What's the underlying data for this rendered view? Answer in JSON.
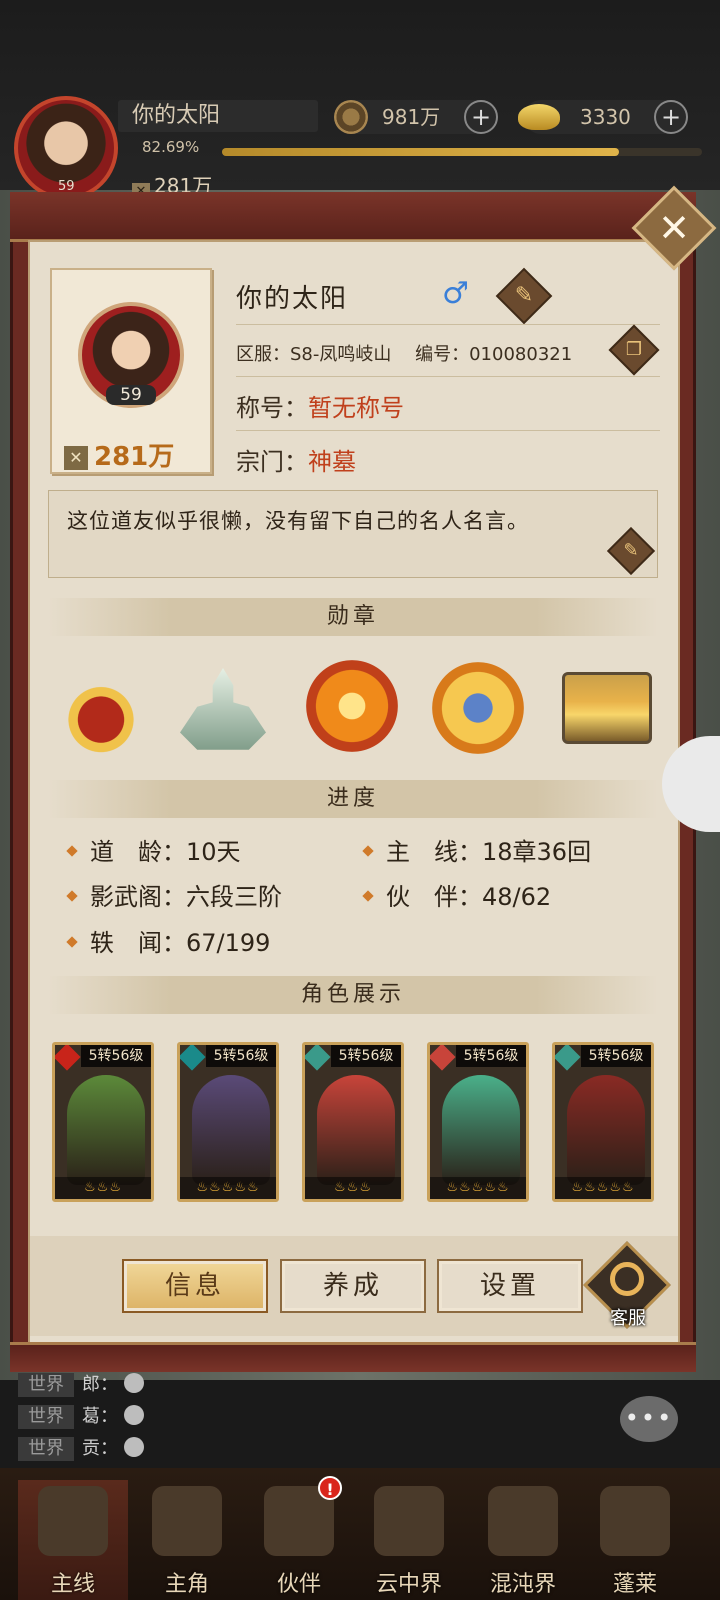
{
  "top_bar": {
    "player_name": "你的太阳",
    "level": "59",
    "exp_percent_text": "82.69%",
    "exp_fraction": 0.8269,
    "power": "281万",
    "coins": "981万",
    "ingots": "3330"
  },
  "profile": {
    "name": "你的太阳",
    "gender_symbol": "♂",
    "level": "59",
    "power": "281万",
    "server_label": "区服：",
    "server_value": "S8-凤鸣岐山",
    "id_label": "编号：",
    "id_value": "010080321",
    "title_label": "称号：",
    "title_value": "暂无称号",
    "sect_label": "宗门：",
    "sect_value": "神墓",
    "motto": "这位道友似乎很懒，没有留下自己的名人名言。"
  },
  "sections": {
    "medals": "勋章",
    "progress": "进度",
    "characters": "角色展示"
  },
  "progress": {
    "dao_age_label": "道　龄：",
    "dao_age_value": "10天",
    "main_line_label": "主　线：",
    "main_line_value": "18章36回",
    "shadow_label": "影武阁：",
    "shadow_value": "六段三阶",
    "partner_label": "伙　伴：",
    "partner_value": "48/62",
    "lore_label": "轶　闻：",
    "lore_value": "67/199"
  },
  "heroes": [
    {
      "level": "5转56级",
      "stars": "♨♨♨",
      "color": "#5c8a3a"
    },
    {
      "level": "5转56级",
      "stars": "♨♨♨♨♨",
      "color": "#5a4a78"
    },
    {
      "level": "5转56级",
      "stars": "♨♨♨",
      "color": "#c8443a"
    },
    {
      "level": "5转56级",
      "stars": "♨♨♨♨♨",
      "color": "#4ab08a"
    },
    {
      "level": "5转56级",
      "stars": "♨♨♨♨♨",
      "color": "#8a2a24"
    }
  ],
  "tabs": {
    "info": "信息",
    "develop": "养成",
    "settings": "设置",
    "service": "客服"
  },
  "chat": [
    {
      "channel": "世界",
      "text": "郎："
    },
    {
      "channel": "世界",
      "text": "葛："
    },
    {
      "channel": "世界",
      "text": "贡："
    }
  ],
  "chat_button": "•••",
  "nav": {
    "main_line": "主线",
    "main_char": "主角",
    "partner": "伙伴",
    "cloud_realm": "云中界",
    "chaos_realm": "混沌界",
    "penglai": "蓬莱",
    "badge": "!"
  }
}
